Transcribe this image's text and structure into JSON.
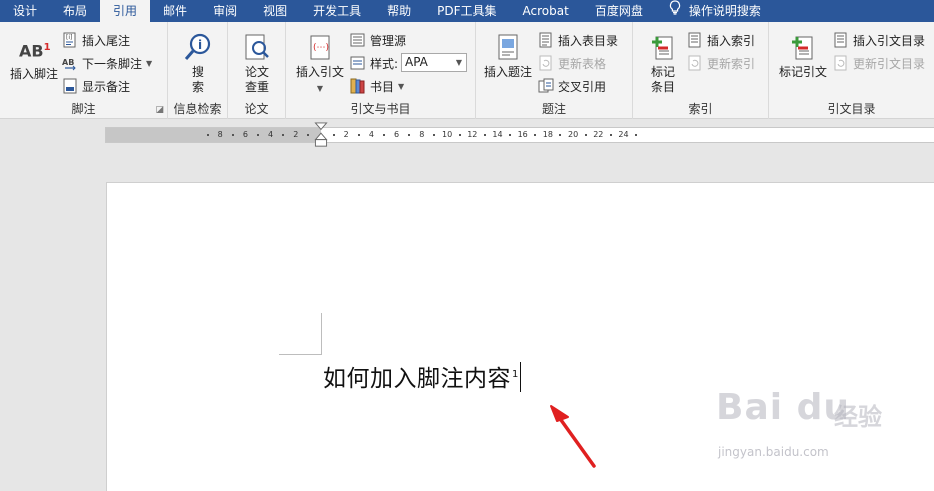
{
  "tabs": [
    "设计",
    "布局",
    "引用",
    "邮件",
    "审阅",
    "视图",
    "开发工具",
    "帮助",
    "PDF工具集",
    "Acrobat",
    "百度网盘",
    "操作说明搜索"
  ],
  "active_tab": "引用",
  "ribbon": {
    "footnotes": {
      "label": "脚注",
      "insert_footnote": "插入脚注",
      "insert_footnote_icon_text": "AB",
      "insert_footnote_superscript": "1",
      "insert_endnote": "插入尾注",
      "next_footnote": "下一条脚注",
      "show_notes": "显示备注"
    },
    "research": {
      "label": "信息检索",
      "search_line1": "搜",
      "search_line2": "索"
    },
    "paper": {
      "label": "论文",
      "check_line1": "论文",
      "check_line2": "查重"
    },
    "citations": {
      "label": "引文与书目",
      "insert_citation": "插入引文",
      "manage_sources": "管理源",
      "style_label": "样式:",
      "style_value": "APA",
      "bibliography": "书目"
    },
    "captions": {
      "label": "题注",
      "insert_caption": "插入题注",
      "insert_table_of_figures": "插入表目录",
      "update_table": "更新表格",
      "cross_reference": "交叉引用"
    },
    "index": {
      "label": "索引",
      "mark_entry_line1": "标记",
      "mark_entry_line2": "条目",
      "insert_index": "插入索引",
      "update_index": "更新索引"
    },
    "table_of_authorities": {
      "label": "引文目录",
      "mark_citation": "标记引文",
      "insert_toa": "插入引文目录",
      "update_toa": "更新引文目录"
    }
  },
  "ruler": {
    "left_ticks": [
      "8",
      "6",
      "4",
      "2"
    ],
    "right_ticks": [
      "2",
      "4",
      "6",
      "8",
      "10",
      "12",
      "14",
      "16",
      "18",
      "20",
      "22",
      "24"
    ]
  },
  "document": {
    "text": "如何加入脚注内容",
    "footnote_ref": "1"
  },
  "watermark": {
    "brand": "Bai du",
    "cn": "经验",
    "url": "jingyan.baidu.com"
  },
  "colors": {
    "tab_bar": "#2b579a",
    "ribbon": "#f3f3f3",
    "arrow": "#e02020",
    "accent_blue": "#2b579a"
  }
}
